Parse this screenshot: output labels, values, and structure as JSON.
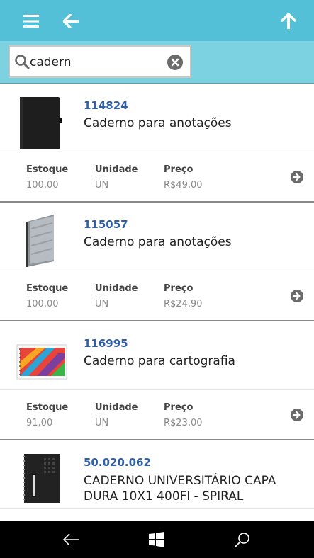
{
  "header": {
    "menu_icon": "hamburger-menu-icon",
    "back_icon": "arrow-left-icon",
    "up_icon": "arrow-up-icon",
    "bg_color": "#53c0d8"
  },
  "search": {
    "value": "cadern",
    "search_icon": "magnifier-icon",
    "clear_icon": "clear-x-icon",
    "bg_color": "#7dd2e2"
  },
  "labels": {
    "estoque": "Estoque",
    "unidade": "Unidade",
    "preco": "Preço"
  },
  "products": [
    {
      "code": "114824",
      "name": "Caderno para anotações",
      "estoque": "100,00",
      "unidade": "UN",
      "preco": "R$49,00",
      "thumb": "black-notebook"
    },
    {
      "code": "115057",
      "name": "Caderno para anotações",
      "estoque": "100,00",
      "unidade": "UN",
      "preco": "R$24,90",
      "thumb": "gray-notebook"
    },
    {
      "code": "116995",
      "name": "Caderno para cartografia",
      "estoque": "91,00",
      "unidade": "UN",
      "preco": "R$23,00",
      "thumb": "colorful-spiral-notebook"
    },
    {
      "code": "50.020.062",
      "name": "CADERNO UNIVERSITÁRIO CAPA DURA 10X1 400Fl - SPIRAL",
      "thumb": "dark-spiral-notebook"
    }
  ],
  "navbar": {
    "back_icon": "back-arrow-icon",
    "windows_icon": "windows-logo-icon",
    "search_icon": "search-icon"
  }
}
